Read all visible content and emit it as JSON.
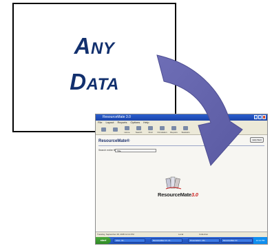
{
  "databox": {
    "line1_first": "A",
    "line1_rest": "NY",
    "line2_first": "D",
    "line2_rest": "ATA"
  },
  "app": {
    "window_title": "ResourceMate 3.0",
    "menu": [
      "File",
      "Layout",
      "Reports",
      "Options",
      "Help"
    ],
    "toolbar": [
      {
        "label": "",
        "icon": "back-icon"
      },
      {
        "label": "",
        "icon": "forward-icon"
      },
      {
        "label": "Home",
        "icon": "home-icon"
      },
      {
        "label": "Search",
        "icon": "search-icon"
      },
      {
        "label": "Find",
        "icon": "find-icon"
      },
      {
        "label": "Circulation",
        "icon": "circulation-icon"
      },
      {
        "label": "Reports",
        "icon": "reports-icon"
      },
      {
        "label": "Statistics",
        "icon": "statistics-icon"
      }
    ],
    "heading": "ResourceMate®",
    "search_label": "Search entire file(s)",
    "search_value": "Title",
    "help_button": "Help Start",
    "logo_text": "ResourceMate",
    "logo_version": "3.0",
    "status": {
      "date": "Tuesday, September 28, 2005 12:14 PM",
      "mode": "Local",
      "db": "Collection"
    },
    "taskbar": {
      "start": "start",
      "tasks": [
        "Inbox - Mi...",
        "ResourceMate 3.0 - M...",
        "Presentation4 - Mic...",
        "ResourceMate 3.0"
      ],
      "clock": "12:14 PM"
    }
  },
  "colors": {
    "arrow": "#6a6ab0",
    "databox_text": "#12306e"
  }
}
